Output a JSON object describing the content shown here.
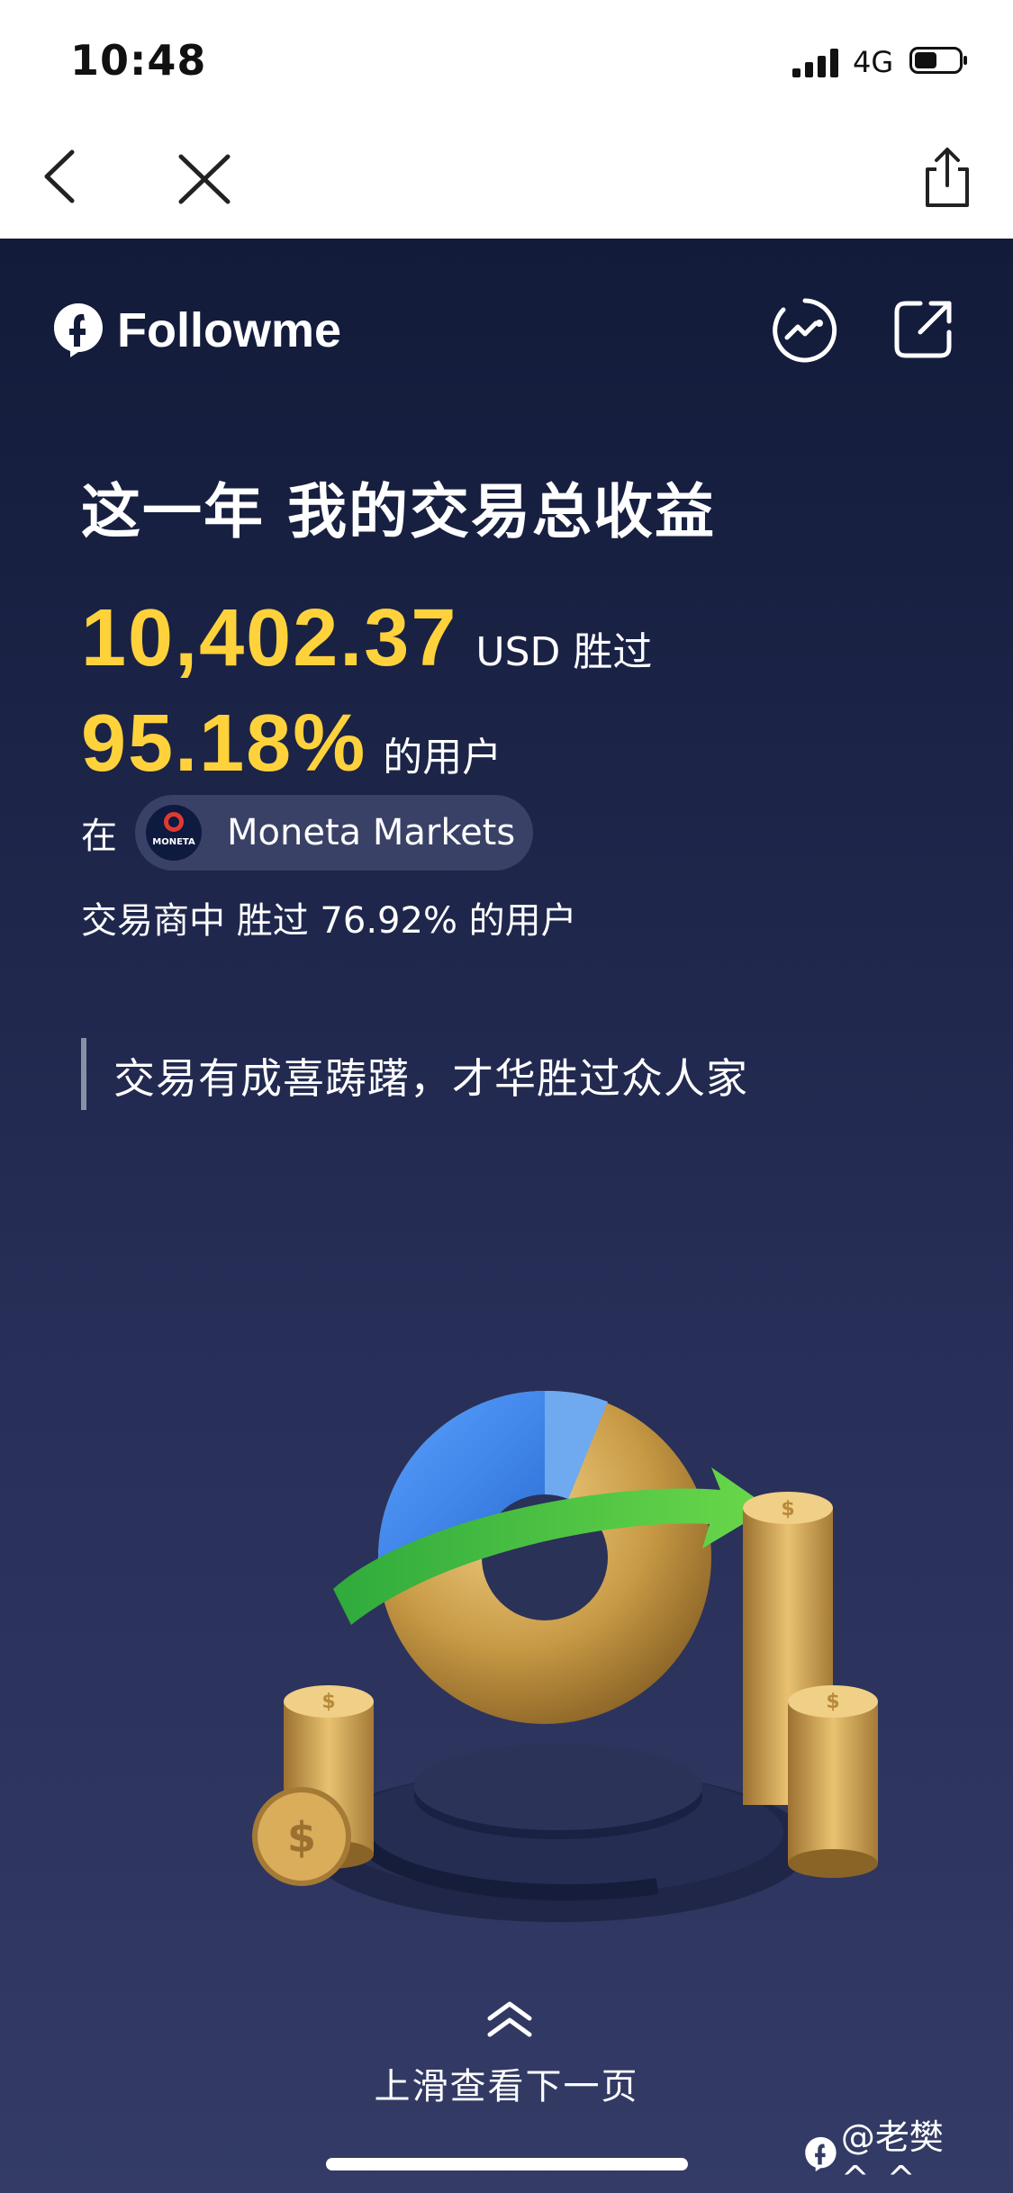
{
  "status_bar": {
    "time": "10:48",
    "network": "4G"
  },
  "brand": {
    "name": "Followme"
  },
  "headline": "这一年 我的交易总收益",
  "profit": {
    "amount": "10,402.37",
    "unit_suffix": "USD 胜过"
  },
  "percentile": {
    "value": "95.18%",
    "suffix": "的用户"
  },
  "broker": {
    "prefix": "在",
    "name": "Moneta Markets",
    "logo_text": "MONETA"
  },
  "broker_line": "交易商中 胜过 76.92% 的用户",
  "quote": "交易有成喜踌躇，才华胜过众人家",
  "footer": {
    "swipe_hint": "上滑查看下一页",
    "watermark": "@老樊^_^"
  },
  "colors": {
    "highlight": "#ffd23c",
    "background_top": "#131b3a",
    "background_bottom": "#333b66"
  },
  "icons": [
    "back-arrow-icon",
    "close-icon",
    "share-icon",
    "followme-logo-icon",
    "trend-icon",
    "external-link-icon",
    "swipe-up-icon"
  ]
}
